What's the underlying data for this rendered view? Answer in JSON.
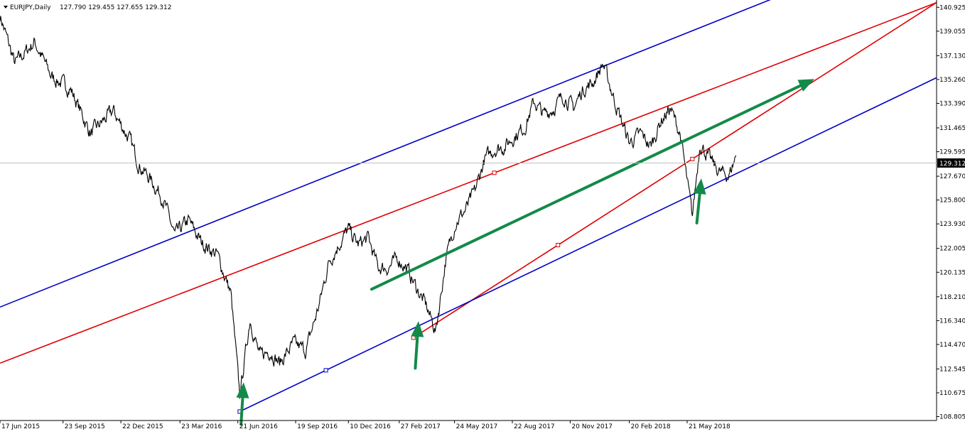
{
  "header": {
    "symbol": "EURJPY,Daily",
    "ohlc": "127.790 129.455 127.655 129.312"
  },
  "current_price": "129.312",
  "colors": {
    "price": "#000000",
    "red_channel": "#e00000",
    "blue_channel": "#0000c8",
    "arrow": "#138a48",
    "grid": "#c0c0c0",
    "tag_bg": "#000000"
  },
  "chart_data": {
    "type": "line",
    "title": "",
    "xlabel": "",
    "ylabel": "",
    "ylim": [
      108.5,
      141.5
    ],
    "xlim": [
      "2015-06-17",
      "2019-06-13"
    ],
    "yticks": [
      "140.925",
      "139.055",
      "137.130",
      "135.260",
      "133.390",
      "131.465",
      "129.595",
      "127.670",
      "125.800",
      "123.930",
      "122.005",
      "120.135",
      "118.210",
      "116.340",
      "114.470",
      "112.545",
      "110.675",
      "108.805"
    ],
    "xticks": [
      {
        "label": "17 Jun 2015",
        "date": "2015-06-17"
      },
      {
        "label": "23 Sep 2015",
        "date": "2015-09-23"
      },
      {
        "label": "22 Dec 2015",
        "date": "2015-12-22"
      },
      {
        "label": "23 Mar 2016",
        "date": "2016-03-23"
      },
      {
        "label": "21 Jun 2016",
        "date": "2016-06-21"
      },
      {
        "label": "19 Sep 2016",
        "date": "2016-09-19"
      },
      {
        "label": "10 Dec 2016",
        "date": "2016-12-10"
      },
      {
        "label": "27 Feb 2017",
        "date": "2017-02-27"
      },
      {
        "label": "24 May 2017",
        "date": "2017-05-24"
      },
      {
        "label": "22 Aug 2017",
        "date": "2017-08-22"
      },
      {
        "label": "20 Nov 2017",
        "date": "2017-11-20"
      },
      {
        "label": "20 Feb 2018",
        "date": "2018-02-20"
      },
      {
        "label": "21 May 2018",
        "date": "2018-05-21"
      }
    ],
    "series": [
      {
        "name": "",
        "x": [
          "2015-06-17",
          "2015-07-10",
          "2015-08-10",
          "2015-09-05",
          "2015-10-05",
          "2015-11-05",
          "2015-12-10",
          "2016-01-05",
          "2016-01-20",
          "2016-02-05",
          "2016-02-25",
          "2016-03-15",
          "2016-04-05",
          "2016-04-25",
          "2016-05-20",
          "2016-06-10",
          "2016-06-24",
          "2016-07-10",
          "2016-07-25",
          "2016-08-10",
          "2016-08-25",
          "2016-09-15",
          "2016-10-05",
          "2016-10-25",
          "2016-11-10",
          "2016-11-25",
          "2016-12-10",
          "2016-12-25",
          "2017-01-10",
          "2017-01-25",
          "2017-02-10",
          "2017-02-25",
          "2017-03-10",
          "2017-03-25",
          "2017-04-10",
          "2017-04-25",
          "2017-05-10",
          "2017-05-25",
          "2017-06-10",
          "2017-06-25",
          "2017-07-10",
          "2017-07-25",
          "2017-08-10",
          "2017-08-25",
          "2017-09-10",
          "2017-09-25",
          "2017-10-10",
          "2017-10-25",
          "2017-11-10",
          "2017-11-25",
          "2017-12-10",
          "2017-12-25",
          "2018-01-10",
          "2018-02-01",
          "2018-02-20",
          "2018-03-10",
          "2018-03-25",
          "2018-04-10",
          "2018-04-25",
          "2018-05-10",
          "2018-05-29",
          "2018-06-10",
          "2018-06-25",
          "2018-07-10",
          "2018-07-25",
          "2018-08-05"
        ],
        "y": [
          140.3,
          136.5,
          138.2,
          135.5,
          134.5,
          131.0,
          132.8,
          130.5,
          128.5,
          127.5,
          126.0,
          123.0,
          124.2,
          122.5,
          121.5,
          118.5,
          110.4,
          116.5,
          113.5,
          114.0,
          113.0,
          114.5,
          114.0,
          117.5,
          121.0,
          122.3,
          123.5,
          122.3,
          122.8,
          120.5,
          120.5,
          121.2,
          120.5,
          119.0,
          117.5,
          115.5,
          121.0,
          124.0,
          125.0,
          126.5,
          129.0,
          129.8,
          130.0,
          130.8,
          131.5,
          133.5,
          132.5,
          133.0,
          134.0,
          133.0,
          134.5,
          135.0,
          136.5,
          133.0,
          130.3,
          131.0,
          130.0,
          132.0,
          133.0,
          131.0,
          124.5,
          130.3,
          129.0,
          128.0,
          127.7,
          129.3
        ]
      }
    ],
    "trendlines": [
      {
        "name": "",
        "color": "#e00000",
        "points": [
          [
            "2015-06-17",
            113.0
          ],
          [
            "2019-06-13",
            141.3
          ]
        ]
      },
      {
        "name": "",
        "color": "#e00000",
        "points": [
          [
            "2017-03-21",
            115.0
          ],
          [
            "2019-06-13",
            141.3
          ]
        ]
      },
      {
        "name": "",
        "color": "#0000c8",
        "points": [
          [
            "2015-06-17",
            117.4
          ],
          [
            "2018-10-01",
            141.6
          ]
        ]
      },
      {
        "name": "",
        "color": "#0000c8",
        "points": [
          [
            "2016-06-24",
            109.2
          ],
          [
            "2019-06-13",
            135.4
          ]
        ]
      }
    ],
    "arrows": [
      {
        "from": [
          "2016-06-26",
          108.2
        ],
        "to": [
          "2016-06-30",
          111.5
        ]
      },
      {
        "from": [
          "2017-03-24",
          112.6
        ],
        "to": [
          "2017-03-29",
          116.3
        ]
      },
      {
        "from": [
          "2018-06-05",
          124.0
        ],
        "to": [
          "2018-06-12",
          127.5
        ]
      },
      {
        "from": [
          "2017-01-15",
          118.8
        ],
        "to": [
          "2018-12-05",
          135.3
        ]
      }
    ],
    "grid": false,
    "legend": "none"
  }
}
